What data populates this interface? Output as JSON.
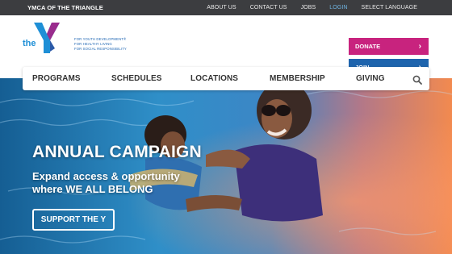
{
  "topbar": {
    "org_name": "YMCA OF THE TRIANGLE",
    "links": [
      "ABOUT US",
      "CONTACT US",
      "JOBS",
      "LOGIN",
      "SELECT LANGUAGE"
    ]
  },
  "logo": {
    "wordmark": "the",
    "tagline": [
      "FOR YOUTH DEVELOPMENT®",
      "FOR HEALTHY LIVING",
      "FOR SOCIAL RESPONSIBILITY"
    ]
  },
  "cta": {
    "donate_label": "DONATE",
    "join_label": "JOIN"
  },
  "nav": {
    "items": [
      "PROGRAMS",
      "SCHEDULES",
      "LOCATIONS",
      "MEMBERSHIP",
      "GIVING"
    ],
    "search_icon": "search-icon"
  },
  "hero": {
    "headline": "ANNUAL CAMPAIGN",
    "subhead": "Expand access & opportunity where WE ALL BELONG",
    "button_label": "SUPPORT THE Y"
  },
  "colors": {
    "topbar": "#3c3d40",
    "donate": "#c8237e",
    "join": "#1e64ad",
    "login_link": "#6fb3e0",
    "logo_blue": "#1e8fd6",
    "logo_purple": "#9a2c8d"
  }
}
